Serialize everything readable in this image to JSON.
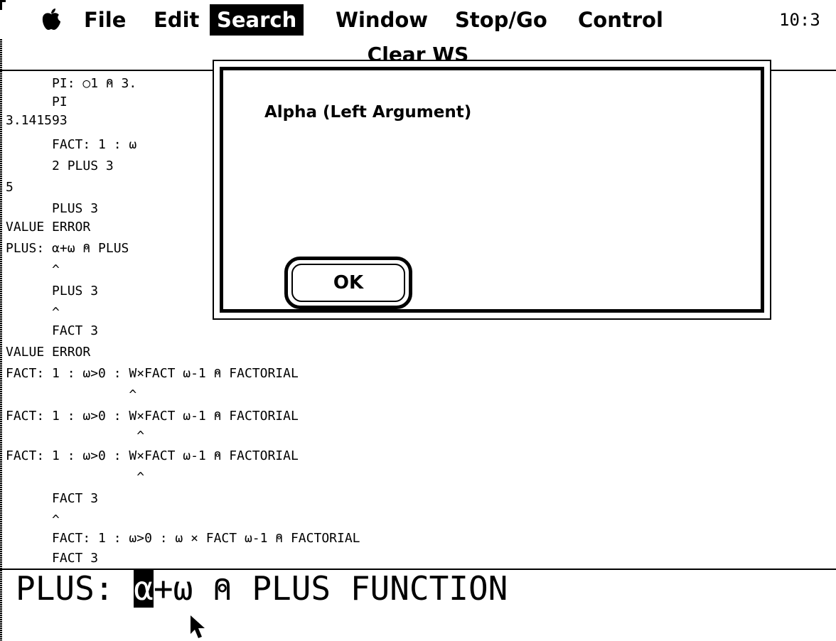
{
  "menubar": {
    "apple": "apple-icon",
    "items": [
      "File",
      "Edit",
      "Search",
      "Window",
      "Stop/Go",
      "Control"
    ],
    "active": "Search",
    "clock": "10:3"
  },
  "window": {
    "title": "Clear WS"
  },
  "session": [
    "      PI: ○1 ⍝ 3.",
    "      PI",
    "3.141593",
    "      FACT: 1 : ω",
    "      2 PLUS 3",
    "5",
    "      PLUS 3",
    "VALUE ERROR",
    "PLUS: α+ω ⍝ PLUS",
    "      ^",
    "      PLUS 3",
    "      ^",
    "      FACT 3",
    "VALUE ERROR",
    "FACT: 1 : ω>0 : W×FACT ω-1 ⍝ FACTORIAL",
    "                ^",
    "FACT: 1 : ω>0 : W×FACT ω-1 ⍝ FACTORIAL",
    "                 ^",
    "FACT: 1 : ω>0 : W×FACT ω-1 ⍝ FACTORIAL",
    "                 ^",
    "      FACT 3",
    "      ^",
    "      FACT: 1 : ω>0 : ω × FACT ω-1 ⍝ FACTORIAL",
    "      FACT 3"
  ],
  "edit_line": {
    "prefix": "PLUS: ",
    "cursor_char": "α",
    "suffix": "+ω ⍝ PLUS FUNCTION"
  },
  "dialog": {
    "message": "Alpha (Left Argument)",
    "ok_label": "OK"
  }
}
